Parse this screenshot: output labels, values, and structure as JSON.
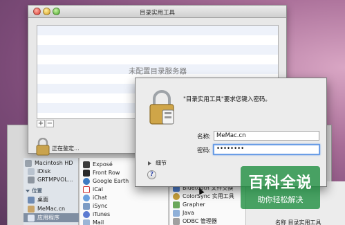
{
  "main_window": {
    "title": "目录实用工具",
    "empty_message": "未配置目录服务器",
    "add_label": "+",
    "remove_label": "−",
    "lock_status": "正在鉴定..."
  },
  "auth_dialog": {
    "prompt": "\"目录实用工具\"要求您键入密码。",
    "name_label": "名称:",
    "name_value": "MeMac.cn",
    "password_label": "密码:",
    "password_value": "••••••••",
    "details_label": "细节",
    "help_label": "?"
  },
  "finder_sidebar": {
    "items": [
      {
        "label": "Macintosh HD"
      },
      {
        "label": "iDisk"
      },
      {
        "label": "GRTMPVOL..."
      },
      {
        "label": "位置"
      },
      {
        "label": "桌面"
      },
      {
        "label": "MeMac.cn"
      },
      {
        "label": "应用程序"
      }
    ]
  },
  "finder_apps": {
    "items": [
      {
        "label": "Exposé"
      },
      {
        "label": "Front Row"
      },
      {
        "label": "Google Earth"
      },
      {
        "label": "iCal"
      },
      {
        "label": "iChat"
      },
      {
        "label": "iSync"
      },
      {
        "label": "iTunes"
      },
      {
        "label": "Mail"
      }
    ]
  },
  "finder_utilities": {
    "items": [
      {
        "label": "Bluetooth 文件交换"
      },
      {
        "label": "ColorSync 实用工具"
      },
      {
        "label": "Grapher"
      },
      {
        "label": "Java"
      },
      {
        "label": "ODBC 管理器"
      }
    ],
    "caption": "名称   目录实用工具"
  },
  "watermark": {
    "main": "百科全说",
    "sub": "助你轻松解决"
  }
}
